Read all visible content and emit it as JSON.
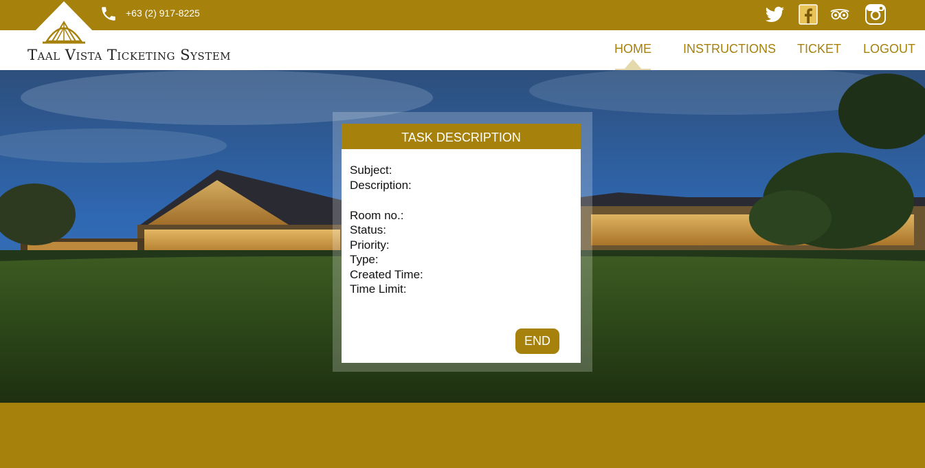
{
  "header": {
    "phone": "+63 (2) 917-8225",
    "brand": "Taal Vista Ticketing System"
  },
  "social": [
    "twitter-icon",
    "facebook-icon",
    "tripadvisor-icon",
    "instagram-icon"
  ],
  "nav": {
    "items": [
      {
        "label": "HOME"
      },
      {
        "label": "INSTRUCTIONS"
      },
      {
        "label": "TICKET"
      },
      {
        "label": "LOGOUT"
      }
    ],
    "active": "HOME"
  },
  "task": {
    "title": "TASK DESCRIPTION",
    "fields": {
      "subject": "Subject:",
      "description": "Description:",
      "room": "Room no.:",
      "status": "Status:",
      "priority": "Priority:",
      "type": "Type:",
      "created": "Created Time:",
      "limit": "Time Limit:"
    },
    "end_label": "END"
  },
  "colors": {
    "brand_gold": "#a6810c",
    "white": "#ffffff",
    "text": "#111111"
  }
}
